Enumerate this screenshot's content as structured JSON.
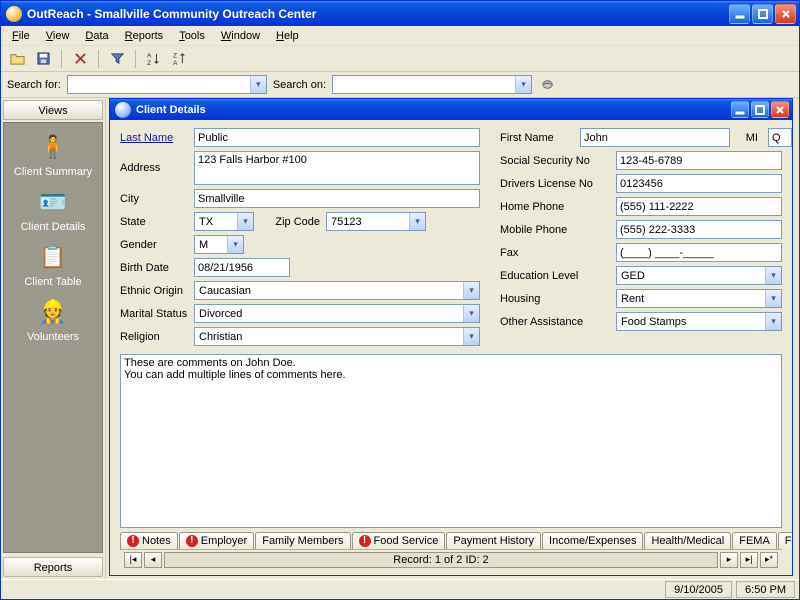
{
  "window": {
    "title": "OutReach - Smallville Community Outreach Center"
  },
  "menu": {
    "items": [
      "File",
      "View",
      "Data",
      "Reports",
      "Tools",
      "Window",
      "Help"
    ]
  },
  "toolbar": {
    "search_for_label": "Search for:",
    "search_for_value": "",
    "search_on_label": "Search on:",
    "search_on_value": ""
  },
  "sidebar": {
    "top_tab": "Views",
    "bottom_tab": "Reports",
    "items": [
      {
        "label": "Client Summary"
      },
      {
        "label": "Client Details"
      },
      {
        "label": "Client Table"
      },
      {
        "label": "Volunteers"
      }
    ]
  },
  "client_window": {
    "title": "Client Details"
  },
  "labels": {
    "last_name": "Last Name",
    "first_name": "First Name",
    "mi": "MI",
    "address": "Address",
    "city": "City",
    "state": "State",
    "zip_code": "Zip Code",
    "gender": "Gender",
    "birth_date": "Birth Date",
    "ethnic_origin": "Ethnic Origin",
    "marital_status": "Marital Status",
    "religion": "Religion",
    "ssn": "Social Security No",
    "dl": "Drivers License No",
    "home_phone": "Home Phone",
    "mobile_phone": "Mobile Phone",
    "fax": "Fax",
    "education": "Education Level",
    "housing": "Housing",
    "other_assistance": "Other Assistance"
  },
  "client": {
    "last_name": "Public",
    "first_name": "John",
    "mi": "Q",
    "address": "123 Falls Harbor #100",
    "city": "Smallville",
    "state": "TX",
    "zip_code": "75123",
    "gender": "M",
    "birth_date": "08/21/1956",
    "ethnic_origin": "Caucasian",
    "marital_status": "Divorced",
    "religion": "Christian",
    "ssn": "123-45-6789",
    "dl": "0123456",
    "home_phone": "(555) 111-2222",
    "mobile_phone": "(555) 222-3333",
    "fax": "(____) ____-_____",
    "education": "GED",
    "housing": "Rent",
    "other_assistance": "Food Stamps",
    "comments": "These are comments on John Doe.\nYou can add multiple lines of comments here."
  },
  "tabs": [
    {
      "label": "Notes",
      "alert": true
    },
    {
      "label": "Employer",
      "alert": true
    },
    {
      "label": "Family Members",
      "alert": false
    },
    {
      "label": "Food Service",
      "alert": true
    },
    {
      "label": "Payment History",
      "alert": false
    },
    {
      "label": "Income/Expenses",
      "alert": false
    },
    {
      "label": "Health/Medical",
      "alert": false
    },
    {
      "label": "FEMA",
      "alert": false
    },
    {
      "label": "Former Address",
      "alert": false
    }
  ],
  "record_nav": {
    "status": "Record: 1 of 2    ID: 2"
  },
  "statusbar": {
    "date": "9/10/2005",
    "time": "6:50 PM"
  }
}
